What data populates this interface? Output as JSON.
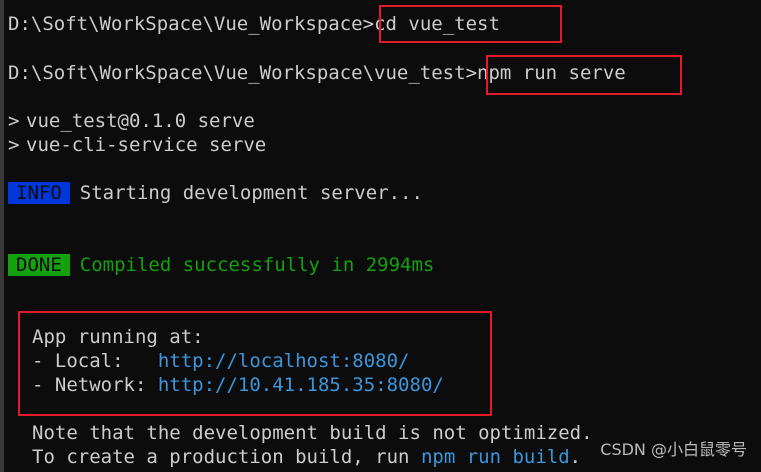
{
  "terminal": {
    "prompt1": {
      "path": "D:\\Soft\\WorkSpace\\Vue_Workspace",
      "sep": ">",
      "command": "cd vue_test"
    },
    "prompt2": {
      "path": "D:\\Soft\\WorkSpace\\Vue_Workspace\\vue_test",
      "sep": ">",
      "command": "npm run serve"
    },
    "npm_lines": [
      {
        "marker": ">",
        "text": "vue_test@0.1.0 serve"
      },
      {
        "marker": ">",
        "text": "vue-cli-service serve"
      }
    ],
    "info": {
      "badge": "INFO",
      "text": "Starting development server..."
    },
    "done": {
      "badge": "DONE",
      "text": "Compiled successfully in 2994ms"
    },
    "running": {
      "heading": "App running at:",
      "local_label": "- Local:   ",
      "local_url": "http://localhost:8080/",
      "network_label": "- Network: ",
      "network_url": "http://10.41.185.35:8080/"
    },
    "note": {
      "line1": "Note that the development build is not optimized.",
      "line2_prefix": "To create a production build, run ",
      "line2_cmd": "npm run build",
      "line2_suffix": "."
    }
  },
  "watermark": "CSDN @小白鼠零号",
  "colors": {
    "background": "#0c0c0c",
    "text": "#cccccc",
    "highlight_box": "#e41a2a",
    "info_badge": "#0037da",
    "done_badge": "#13a10e",
    "url": "#3a96dd"
  }
}
